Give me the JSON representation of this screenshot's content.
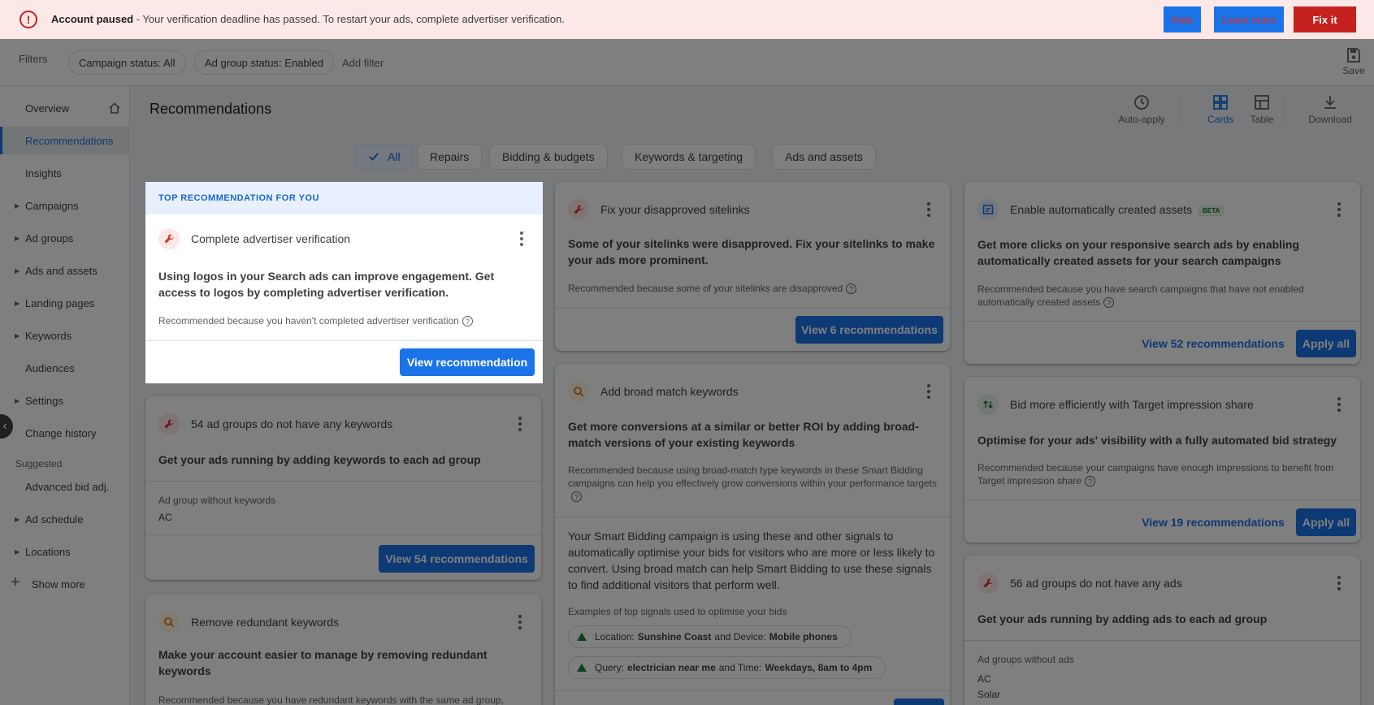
{
  "alert": {
    "title": "Account paused",
    "message": " - Your verification deadline has passed. To restart your ads, complete advertiser verification.",
    "hide_label": "Hide",
    "learn_label": "Learn more",
    "fix_label": "Fix it"
  },
  "filters": {
    "label": "Filters",
    "chips": [
      "Campaign status: All",
      "Ad group status: Enabled"
    ],
    "add_filter": "Add filter",
    "save_label": "Save"
  },
  "sidebar": {
    "items": [
      {
        "label": "Overview"
      },
      {
        "label": "Recommendations"
      },
      {
        "label": "Insights"
      },
      {
        "label": "Campaigns"
      },
      {
        "label": "Ad groups"
      },
      {
        "label": "Ads and assets"
      },
      {
        "label": "Landing pages"
      },
      {
        "label": "Keywords"
      },
      {
        "label": "Audiences"
      },
      {
        "label": "Settings"
      },
      {
        "label": "Change history"
      },
      {
        "label": "Suggested"
      },
      {
        "label": "Advanced bid adj."
      },
      {
        "label": "Ad schedule"
      },
      {
        "label": "Locations"
      },
      {
        "label": "Show more"
      }
    ]
  },
  "header": {
    "title": "Recommendations",
    "tools": [
      "Auto-apply",
      "Cards",
      "Table",
      "Download"
    ]
  },
  "tabs": [
    "All",
    "Repairs",
    "Bidding & budgets",
    "Keywords & targeting",
    "Ads and assets"
  ],
  "cards": {
    "top": {
      "band": "TOP RECOMMENDATION FOR YOU",
      "title": "Complete advertiser verification",
      "body": "Using logos in your Search ads can improve engagement. Get access to logos by completing advertiser verification.",
      "reason": "Recommended because you haven't completed advertiser verification",
      "button": "View recommendation"
    },
    "keywords54": {
      "title": "54 ad groups do not have any keywords",
      "body": "Get your ads running by adding keywords to each ad group",
      "sub_label": "Ad group without keywords",
      "sub_value": "AC",
      "button": "View 54 recommendations"
    },
    "redundant": {
      "title": "Remove redundant keywords",
      "body": "Make your account easier to manage by removing redundant keywords",
      "reason": "Recommended because you have redundant keywords with the same ad group,"
    },
    "sitelinks": {
      "title": "Fix your disapproved sitelinks",
      "body": "Some of your sitelinks were disapproved. Fix your sitelinks to make your ads more prominent.",
      "reason": "Recommended because some of your sitelinks are disapproved",
      "button": "View 6 recommendations"
    },
    "broad": {
      "title": "Add broad match keywords",
      "body": "Get more conversions at a similar or better ROI by adding broad-match versions of your existing keywords",
      "reason": "Recommended because using broad-match type keywords in these Smart Bidding campaigns can help you effectively grow conversions within your performance targets",
      "detail": "Your Smart Bidding campaign is using these and other signals to automatically optimise your bids for visitors who are more or less likely to convert. Using broad match can help Smart Bidding to use these signals to find additional visitors that perform well.",
      "signals_label": "Examples of top signals used to optimise your bids",
      "signal1": {
        "a": "Location:",
        "b": "Sunshine Coast",
        "c": "and Device:",
        "d": "Mobile phones"
      },
      "signal2": {
        "a": "Query:",
        "b": "electrician near me",
        "c": "and Time:",
        "d": "Weekdays, 8am to 4pm"
      }
    },
    "assets": {
      "title": "Enable automatically created assets",
      "beta": "BETA",
      "body": "Get more clicks on your responsive search ads by enabling automatically created assets for your search campaigns",
      "reason": "Recommended because you have search campaigns that have not enabled automatically created assets",
      "view_label": "View 52 recommendations",
      "apply_label": "Apply all"
    },
    "tis": {
      "title": "Bid more efficiently with Target impression share",
      "body": "Optimise for your ads' visibility with a fully automated bid strategy",
      "reason": "Recommended because your campaigns have enough impressions to benefit from Target impression share",
      "view_label": "View 19 recommendations",
      "apply_label": "Apply all"
    },
    "ads56": {
      "title": "56 ad groups do not have any ads",
      "body": "Get your ads running by adding ads to each ad group",
      "sub_label": "Ad groups without ads",
      "sub_values": [
        "AC",
        "Solar"
      ]
    }
  },
  "colors": {
    "accent": "#1a73e8",
    "alert_bg": "#fce8e6",
    "danger": "#c5221f"
  }
}
